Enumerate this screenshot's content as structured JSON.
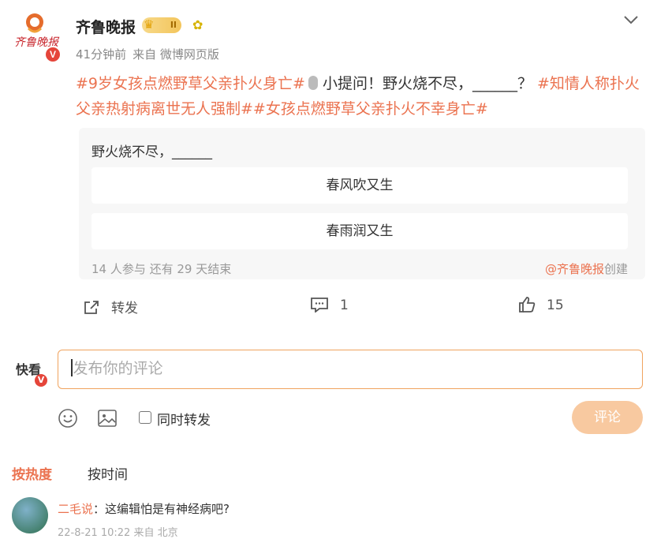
{
  "post": {
    "author": "齐鲁晚报",
    "vip_level": "II",
    "time": "41分钟前",
    "source": "来自 微博网页版",
    "text_parts": [
      {
        "kind": "tag",
        "text": "#9岁女孩点燃野草父亲扑火身亡#"
      },
      {
        "kind": "plain",
        "text": "小提问！野火烧不尽，______？"
      },
      {
        "kind": "tag",
        "text": "#知情人称扑火父亲热射病离世无人强制#"
      },
      {
        "kind": "tag",
        "text": "#女孩点燃野草父亲扑火不幸身亡#"
      }
    ]
  },
  "poll": {
    "question": "野火烧不尽，______",
    "options": [
      "春风吹又生",
      "春雨润又生"
    ],
    "footer": "14 人参与  还有 29 天结束",
    "creator_at": "@齐鲁晚报",
    "creator_suffix": "创建"
  },
  "actions": {
    "repost_label": "转发",
    "comment_count": "1",
    "like_count": "15"
  },
  "comment_box": {
    "label": "快看",
    "placeholder": "发布你的评论",
    "repost_checkbox_label": "同时转发",
    "submit_label": "评论"
  },
  "sort": {
    "hot": "按热度",
    "time": "按时间"
  },
  "comments": [
    {
      "name": "二毛说",
      "text": "：这编辑怕是有神经病吧?",
      "meta": "22-8-21 10:22 来自 北京"
    }
  ],
  "icons": {
    "menu": "chevron-down-icon",
    "repost": "share-icon",
    "comment": "comment-icon",
    "like": "thumbs-up-icon",
    "emoji": "smiley-icon",
    "image": "image-icon"
  },
  "colors": {
    "accent": "#eb7350",
    "input_border": "#f0a35e",
    "submit_bg": "#f8c9a0"
  }
}
